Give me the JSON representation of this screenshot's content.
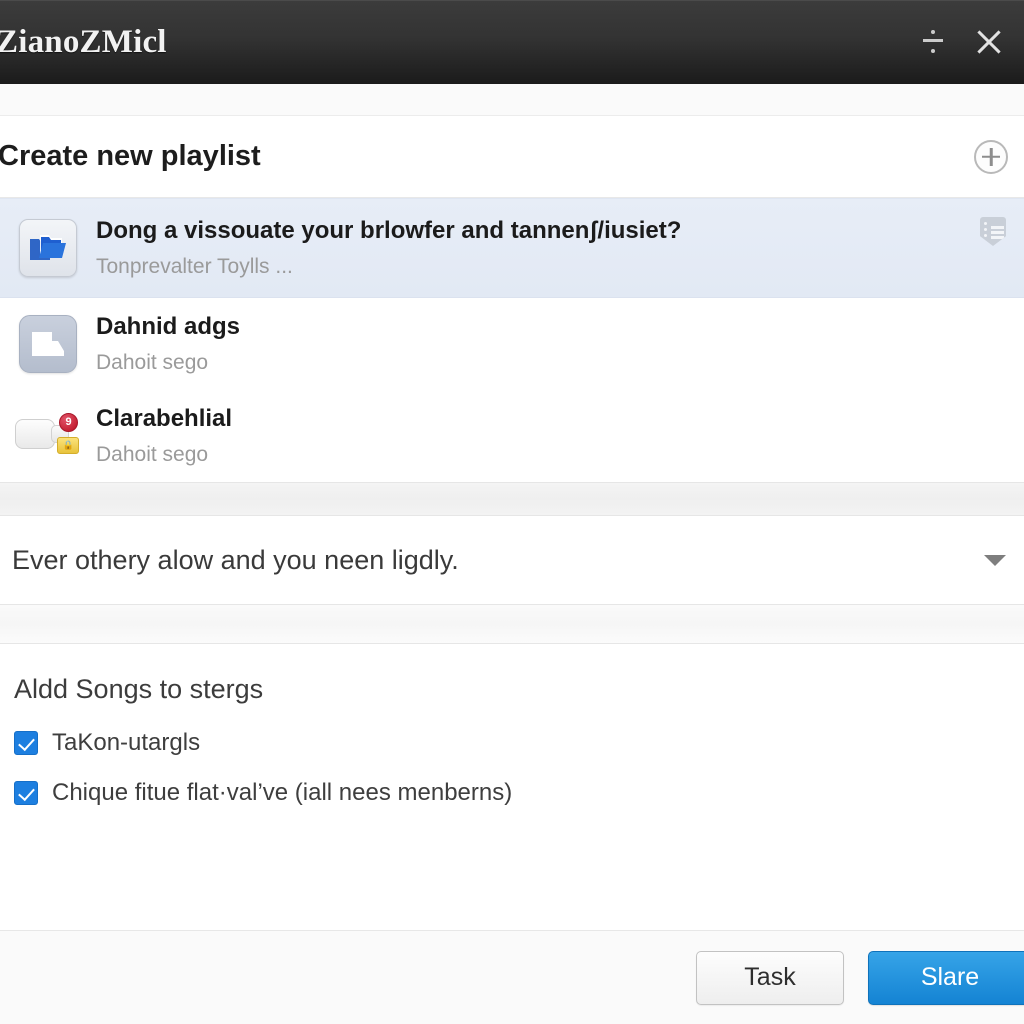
{
  "titlebar": {
    "title": "ZianoZMicl",
    "menu_icon": "divide-menu-icon",
    "close_icon": "close-icon"
  },
  "section": {
    "title": "Create new playlist",
    "add_icon": "plus-circle-icon"
  },
  "list": {
    "items": [
      {
        "title": "Dong a vissouate your brlowfer and tannenʃ/iusiet?",
        "subtitle": "Tonprevalter Toylls ...",
        "icon": "folder-stack-icon",
        "selected": true,
        "badge_icon": "list-shield-icon"
      },
      {
        "title": "Dahnid adgs",
        "subtitle": "Dahoit sego",
        "icon": "photo-tile-icon",
        "selected": false
      },
      {
        "title": "Clarabehlial",
        "subtitle": "Dahoit sego",
        "icon": "device-icon",
        "badge_count": "9",
        "lock_icon": "lock-icon",
        "selected": false
      }
    ]
  },
  "dropdown": {
    "value": "Ever othery alow and you neen ligdly.",
    "chevron_icon": "chevron-down-icon"
  },
  "songs": {
    "heading": "Aldd Songs to stergs",
    "options": [
      {
        "label": "TaKon-utargls",
        "checked": true
      },
      {
        "label": "Chique fitue flat·val’ve (iall nees menberns)",
        "checked": true
      }
    ]
  },
  "footer": {
    "secondary_label": "Task",
    "primary_label": "Slare"
  },
  "colors": {
    "accent_blue": "#1483d3",
    "titlebar_dark": "#2b2b2b",
    "selected_row": "#e4eaf5",
    "badge_red": "#c41f32",
    "lock_yellow": "#e8c33c"
  }
}
